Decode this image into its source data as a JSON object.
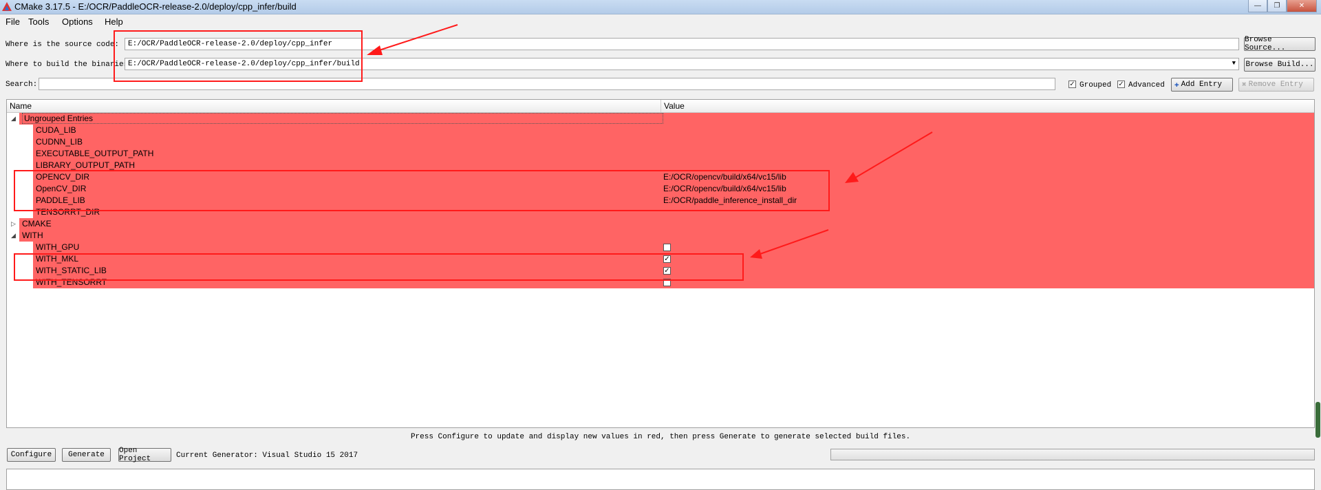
{
  "window": {
    "title": "CMake 3.17.5 - E:/OCR/PaddleOCR-release-2.0/deploy/cpp_infer/build"
  },
  "menu": {
    "file": "File",
    "tools": "Tools",
    "options": "Options",
    "help": "Help"
  },
  "source": {
    "label": "Where is the source code:",
    "value": "E:/OCR/PaddleOCR-release-2.0/deploy/cpp_infer",
    "browse_label": "Browse Source..."
  },
  "binaries": {
    "label": "Where to build the binaries:",
    "value": "E:/OCR/PaddleOCR-release-2.0/deploy/cpp_infer/build",
    "browse_label": "Browse Build..."
  },
  "search": {
    "label": "Search:",
    "value": ""
  },
  "options_bar": {
    "grouped_label": "Grouped",
    "grouped_checked": true,
    "advanced_label": "Advanced",
    "advanced_checked": true,
    "add_entry_label": "Add Entry",
    "remove_entry_label": "Remove Entry"
  },
  "table": {
    "col_name": "Name",
    "col_value": "Value",
    "rows": [
      {
        "name": "Ungrouped Entries",
        "value": "",
        "kind": "group",
        "expanded": true
      },
      {
        "name": "CUDA_LIB",
        "value": "",
        "kind": "entry"
      },
      {
        "name": "CUDNN_LIB",
        "value": "",
        "kind": "entry"
      },
      {
        "name": "EXECUTABLE_OUTPUT_PATH",
        "value": "",
        "kind": "entry"
      },
      {
        "name": "LIBRARY_OUTPUT_PATH",
        "value": "",
        "kind": "entry"
      },
      {
        "name": "OPENCV_DIR",
        "value": "E:/OCR/opencv/build/x64/vc15/lib",
        "kind": "entry"
      },
      {
        "name": "OpenCV_DIR",
        "value": "E:/OCR/opencv/build/x64/vc15/lib",
        "kind": "entry"
      },
      {
        "name": "PADDLE_LIB",
        "value": "E:/OCR/paddle_inference_install_dir",
        "kind": "entry"
      },
      {
        "name": "TENSORRT_DIR",
        "value": "",
        "kind": "entry"
      },
      {
        "name": "CMAKE",
        "value": "",
        "kind": "group",
        "expanded": false
      },
      {
        "name": "WITH",
        "value": "",
        "kind": "group",
        "expanded": true
      },
      {
        "name": "WITH_GPU",
        "checked": false,
        "kind": "bool"
      },
      {
        "name": "WITH_MKL",
        "checked": true,
        "kind": "bool"
      },
      {
        "name": "WITH_STATIC_LIB",
        "checked": true,
        "kind": "bool"
      },
      {
        "name": "WITH_TENSORRT",
        "checked": false,
        "kind": "bool"
      }
    ]
  },
  "status_text": "Press Configure to update and display new values in red, then press Generate to generate selected build files.",
  "bottom": {
    "configure_label": "Configure",
    "generate_label": "Generate",
    "open_project_label": "Open Project",
    "generator_text": "Current Generator: Visual Studio 15 2017",
    "progress": 0
  },
  "colors": {
    "new_entry_red": "#ff6464",
    "annotation_red": "#ff1a1a"
  }
}
